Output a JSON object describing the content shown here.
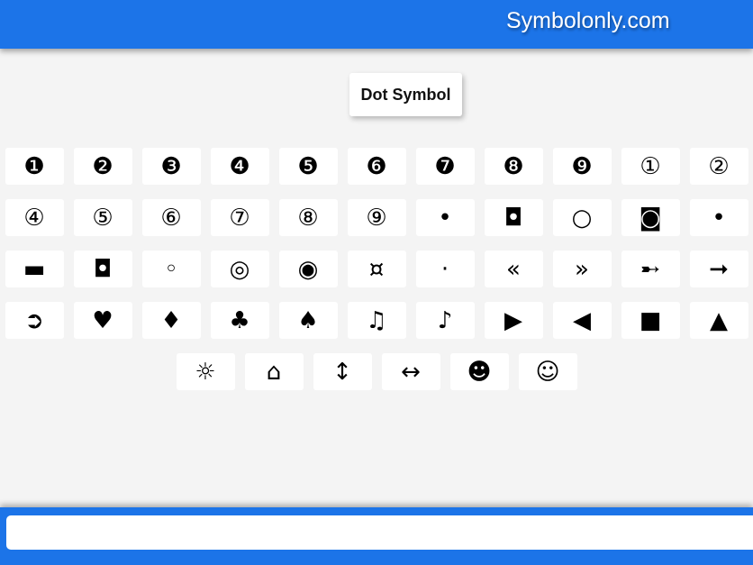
{
  "header": {
    "site_title": "Symbolonly.com"
  },
  "main": {
    "heading": "Dot Symbol",
    "symbols": [
      "❶",
      "❷",
      "❸",
      "❹",
      "❺",
      "❻",
      "❼",
      "❽",
      "❾",
      "①",
      "②",
      "④",
      "⑤",
      "⑥",
      "⑦",
      "⑧",
      "⑨",
      "•",
      "◘",
      "○",
      "◙",
      "•",
      "▬",
      "◘",
      "◦",
      "◎",
      "◉",
      "¤",
      "·",
      "«",
      "»",
      "➸",
      "➞",
      "➲",
      "♥",
      "♦",
      "♣",
      "♠",
      "♫",
      "♪",
      "▶",
      "◀",
      "■",
      "▲",
      "☼",
      "⌂",
      "↕",
      "↔",
      "☻",
      "☺"
    ]
  },
  "footer": {
    "copy_field_value": "",
    "copy_field_placeholder": ""
  }
}
